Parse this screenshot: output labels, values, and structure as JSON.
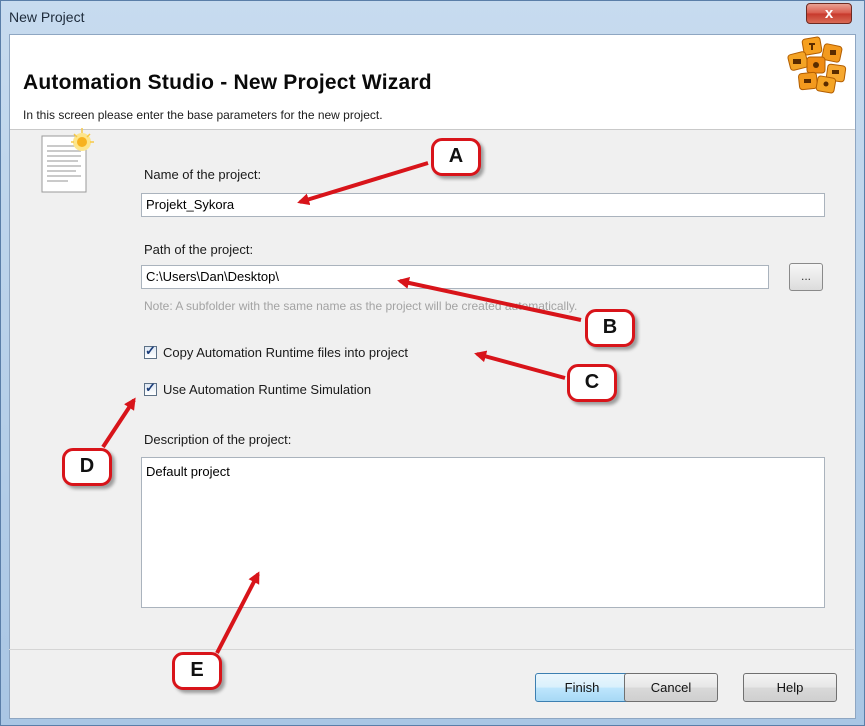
{
  "window": {
    "title": "New Project",
    "close_glyph": "x"
  },
  "header": {
    "title": "Automation Studio - New Project Wizard",
    "subtitle": "In this screen please enter the base parameters for the new project.",
    "logo_icon": "automation-studio-logo-icon"
  },
  "form": {
    "name_label": "Name of the project:",
    "name_value": "Projekt_Sykora",
    "path_label": "Path of the project:",
    "path_value": "C:\\Users\\Dan\\Desktop\\",
    "browse_label": "...",
    "note": "Note: A subfolder with the same name as the project will be created automatically.",
    "copy_runtime_label": "Copy Automation Runtime files into project",
    "copy_runtime_checked": true,
    "simulation_label": "Use Automation Runtime Simulation",
    "simulation_checked": true,
    "description_label": "Description of the project:",
    "description_value": "Default project"
  },
  "buttons": {
    "finish": "Finish",
    "cancel": "Cancel",
    "help": "Help"
  },
  "callouts": {
    "a": "A",
    "b": "B",
    "c": "C",
    "d": "D",
    "e": "E"
  },
  "colors": {
    "accent_red": "#d8141a",
    "logo_orange": "#f39a1e"
  }
}
